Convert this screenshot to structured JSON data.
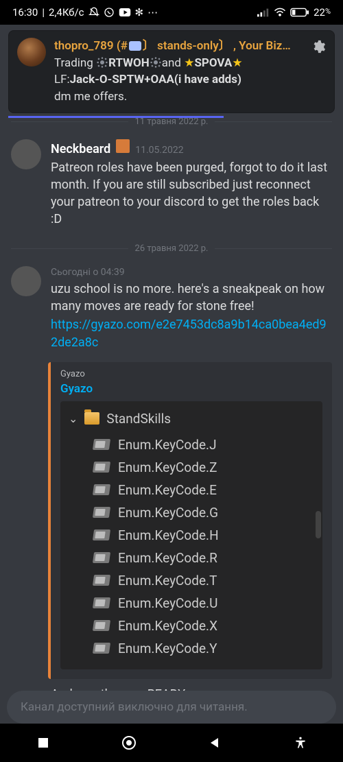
{
  "status": {
    "time": "16:30",
    "net": "2,4Кб/с",
    "battery": "22",
    "battery_suffix": "%"
  },
  "banner": {
    "author": "thopro_789",
    "channel_tag": "(#💬〕 stands-only〕",
    "tail": ", Your Biz…",
    "line2a": "Trading ",
    "line2b": "RTWOH",
    "line2c": "and ",
    "line2d": "SPOVA",
    "line3_prefix": "LF:",
    "line3_bold": "Jack-O-SPTW+OAA(i have adds)",
    "line4": "dm me offers."
  },
  "divider1": "11 травня 2022 р.",
  "msg1": {
    "author": "Neckbeard",
    "date": "11.05.2022",
    "text": "Patreon roles have been purged, forgot to do it last month. If you are still subscribed just reconnect your patreon to your discord to get the roles back :D"
  },
  "divider2": "26 травня 2022 р.",
  "msg2": {
    "timestamp": "Сьогодні о 04:39",
    "text": "uzu school is no more. here's a sneakpeak on how many moves are ready for stone free!",
    "link": "https://gyazo.com/e2e7453dc8a9b14ca0bea4ed92de2a8c"
  },
  "embed": {
    "provider": "Gyazo",
    "title": "Gyazo",
    "folder": "StandSkills",
    "items": [
      "Enum.KeyCode.J",
      "Enum.KeyCode.Z",
      "Enum.KeyCode.E",
      "Enum.KeyCode.G",
      "Enum.KeyCode.H",
      "Enum.KeyCode.R",
      "Enum.KeyCode.T",
      "Enum.KeyCode.U",
      "Enum.KeyCode.X",
      "Enum.KeyCode.Y"
    ]
  },
  "followup": "And yes. they are READY.",
  "input_placeholder": "Канал доступний виключно для читання."
}
